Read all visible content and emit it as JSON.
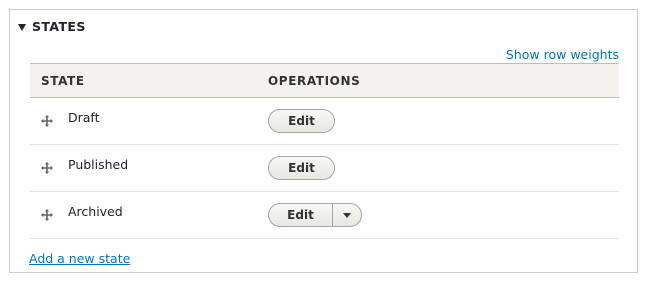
{
  "fieldset": {
    "title": "STATES"
  },
  "links": {
    "row_weights": "Show row weights",
    "add_state": "Add a new state"
  },
  "table": {
    "columns": [
      "STATE",
      "OPERATIONS"
    ],
    "rows": [
      {
        "state": "Draft",
        "operation": "Edit",
        "has_dropdown": false
      },
      {
        "state": "Published",
        "operation": "Edit",
        "has_dropdown": false
      },
      {
        "state": "Archived",
        "operation": "Edit",
        "has_dropdown": true
      }
    ]
  },
  "colors": {
    "link": "#0074bd",
    "header_bg": "#f3f2ee",
    "text": "#222330"
  },
  "icons": {
    "legend": "collapse-triangle-icon",
    "row_handle": "drag-handle-icon",
    "dropdown": "chevron-down-icon"
  }
}
